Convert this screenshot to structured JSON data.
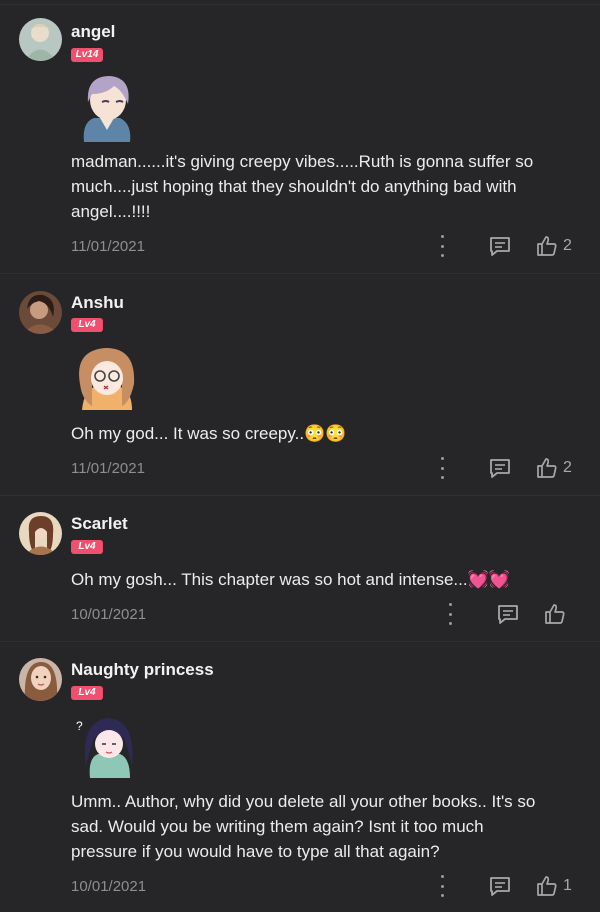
{
  "comments": [
    {
      "user": "angel",
      "level": "Lv14",
      "text": "madman......it's giving creepy vibes.....Ruth is gonna suffer so much....just hoping that they shouldn't do anything bad with angel....!!!!",
      "date": "11/01/2021",
      "likes": "2"
    },
    {
      "user": "Anshu",
      "level": "Lv4",
      "text": "Oh my god... It was so creepy..😳😳",
      "date": "11/01/2021",
      "likes": "2"
    },
    {
      "user": "Scarlet",
      "level": "Lv4",
      "text": "Oh my gosh... This chapter was so hot and intense...💓💓",
      "date": "10/01/2021",
      "likes": ""
    },
    {
      "user": "Naughty princess",
      "level": "Lv4",
      "text": "Umm.. Author, why did you delete all your other books.. It's so sad. Would you be writing them again? Isnt it too much pressure if you would have to type all that again?",
      "date": "10/01/2021",
      "likes": "1"
    }
  ],
  "icons": {
    "more": "more-vertical-icon",
    "reply": "comment-reply-icon",
    "like": "thumbs-up-icon"
  },
  "colors": {
    "background": "#262628",
    "level_badge": "#f0506e",
    "muted": "#8e8e90"
  }
}
